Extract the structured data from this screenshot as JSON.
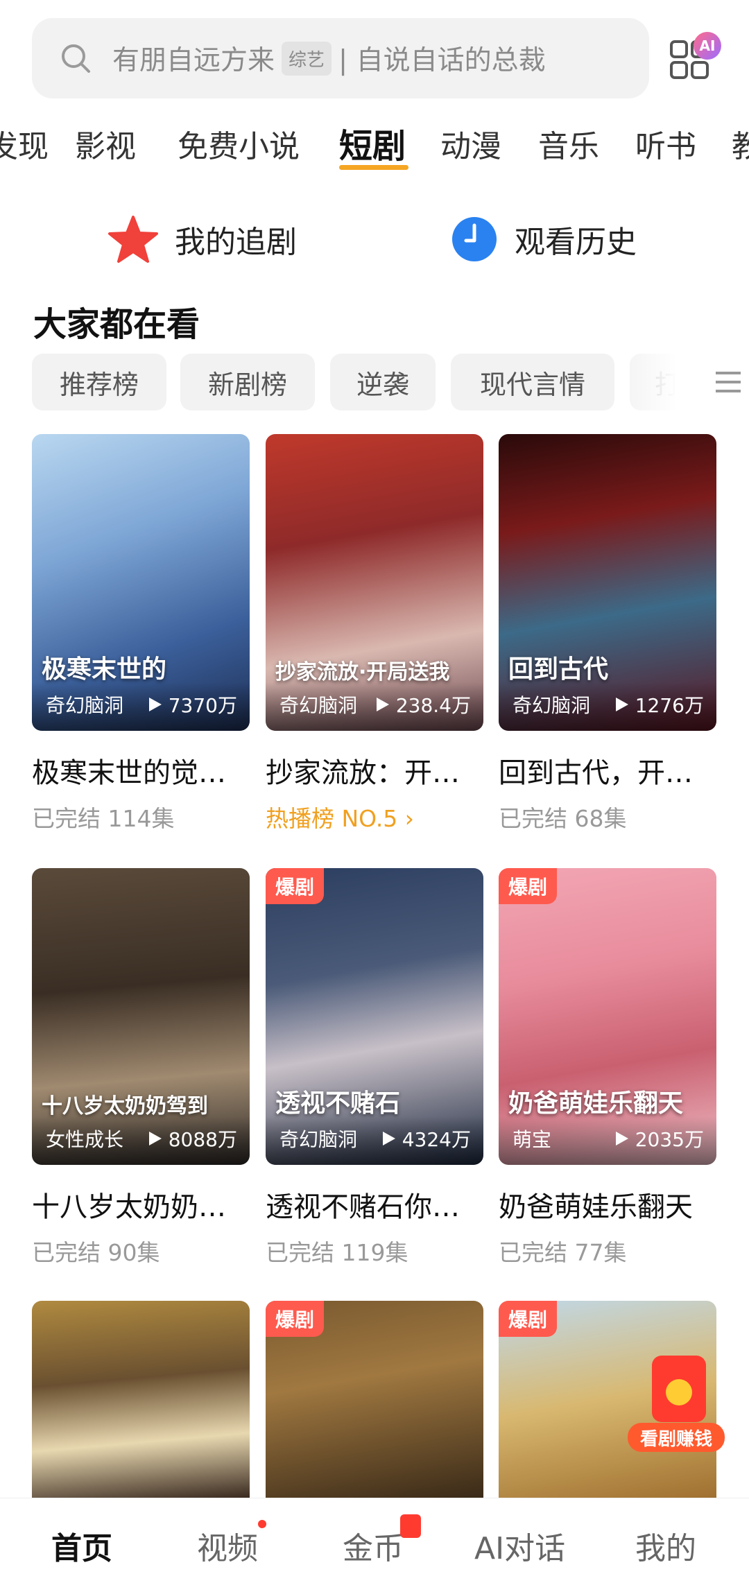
{
  "search": {
    "text_before": "有朋自远方来",
    "tag": "综艺",
    "text_after": "| 自说自话的总裁"
  },
  "ai_badge": "AI",
  "tabs": [
    "发现",
    "影视",
    "免费小说",
    "短剧",
    "动漫",
    "音乐",
    "听书",
    "教"
  ],
  "active_tab": "短剧",
  "quick_links": {
    "follow": "我的追剧",
    "history": "观看历史"
  },
  "section_title": "大家都在看",
  "chips": [
    "推荐榜",
    "新剧榜",
    "逆袭",
    "现代言情",
    "打"
  ],
  "cards": [
    {
      "poster_title": "极寒末世的",
      "genre": "奇幻脑洞",
      "views": "7370万",
      "name": "极寒末世的觉…",
      "meta": "已完结  114集",
      "hot": ""
    },
    {
      "poster_title": "抄家流放·开局送我",
      "genre": "奇幻脑洞",
      "views": "238.4万",
      "name": "抄家流放：开…",
      "meta": "热播榜 NO.5 ›",
      "hot": ""
    },
    {
      "poster_title": "回到古代",
      "genre": "奇幻脑洞",
      "views": "1276万",
      "name": "回到古代，开…",
      "meta": "已完结  68集",
      "hot": ""
    },
    {
      "poster_title": "十八岁太奶奶驾到",
      "genre": "女性成长",
      "views": "8088万",
      "name": "十八岁太奶奶…",
      "meta": "已完结  90集",
      "hot": ""
    },
    {
      "poster_title": "透视不赌石",
      "genre": "奇幻脑洞",
      "views": "4324万",
      "name": "透视不赌石你…",
      "meta": "已完结  119集",
      "hot": "爆剧"
    },
    {
      "poster_title": "奶爸萌娃乐翻天",
      "genre": "萌宝",
      "views": "2035万",
      "name": "奶爸萌娃乐翻天",
      "meta": "已完结  77集",
      "hot": "爆剧"
    },
    {
      "poster_title": "",
      "genre": "",
      "views": "",
      "name": "",
      "meta": "",
      "hot": ""
    },
    {
      "poster_title": "",
      "genre": "",
      "views": "",
      "name": "",
      "meta": "",
      "hot": "爆剧"
    },
    {
      "poster_title": "",
      "genre": "",
      "views": "",
      "name": "",
      "meta": "",
      "hot": "爆剧"
    }
  ],
  "earn_button": "看剧赚钱",
  "bottom_nav": [
    "首页",
    "视频",
    "金币",
    "AI对话",
    "我的"
  ],
  "colors": {
    "accent": "#f5a623",
    "hot_badge": "#ff5a4e",
    "rank_text": "#f0a020"
  }
}
